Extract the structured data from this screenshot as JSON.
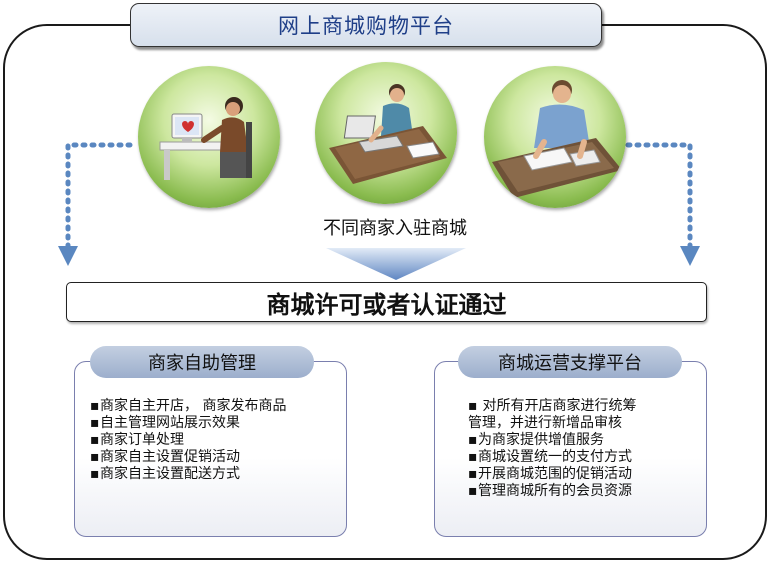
{
  "title": "网上商城购物平台",
  "merchant_caption": "不同商家入驻商城",
  "certification": "商城许可或者认证通过",
  "panels": {
    "left": {
      "header": "商家自助管理",
      "items": [
        "商家自主开店， 商家发布商品",
        "自主管理网站展示效果",
        "商家订单处理",
        "商家自主设置促销活动",
        "商家自主设置配送方式"
      ]
    },
    "right": {
      "header": "商城运营支撑平台",
      "items": [
        " 对所有开店商家进行统筹",
        "管理，并进行新增品审核",
        "为商家提供增值服务",
        "商城设置统一的支付方式",
        "开展商城范围的促销活动",
        "管理商城所有的会员资源"
      ],
      "bullets": [
        true,
        false,
        true,
        true,
        true,
        true
      ]
    }
  },
  "icons": {
    "merchant_1": "person-at-computer-icon",
    "merchant_2": "person-at-desk-icon",
    "merchant_3": "person-writing-icon",
    "left_arrow": "dotted-arrow-down-icon",
    "right_arrow": "dotted-arrow-down-icon",
    "center_arrow": "arrow-down-icon"
  },
  "colors": {
    "title_text": "#1f3f88",
    "dotted_arrow": "#5a87c0",
    "panel_header": "#9caecc",
    "circle_green": "#89bb4e"
  }
}
